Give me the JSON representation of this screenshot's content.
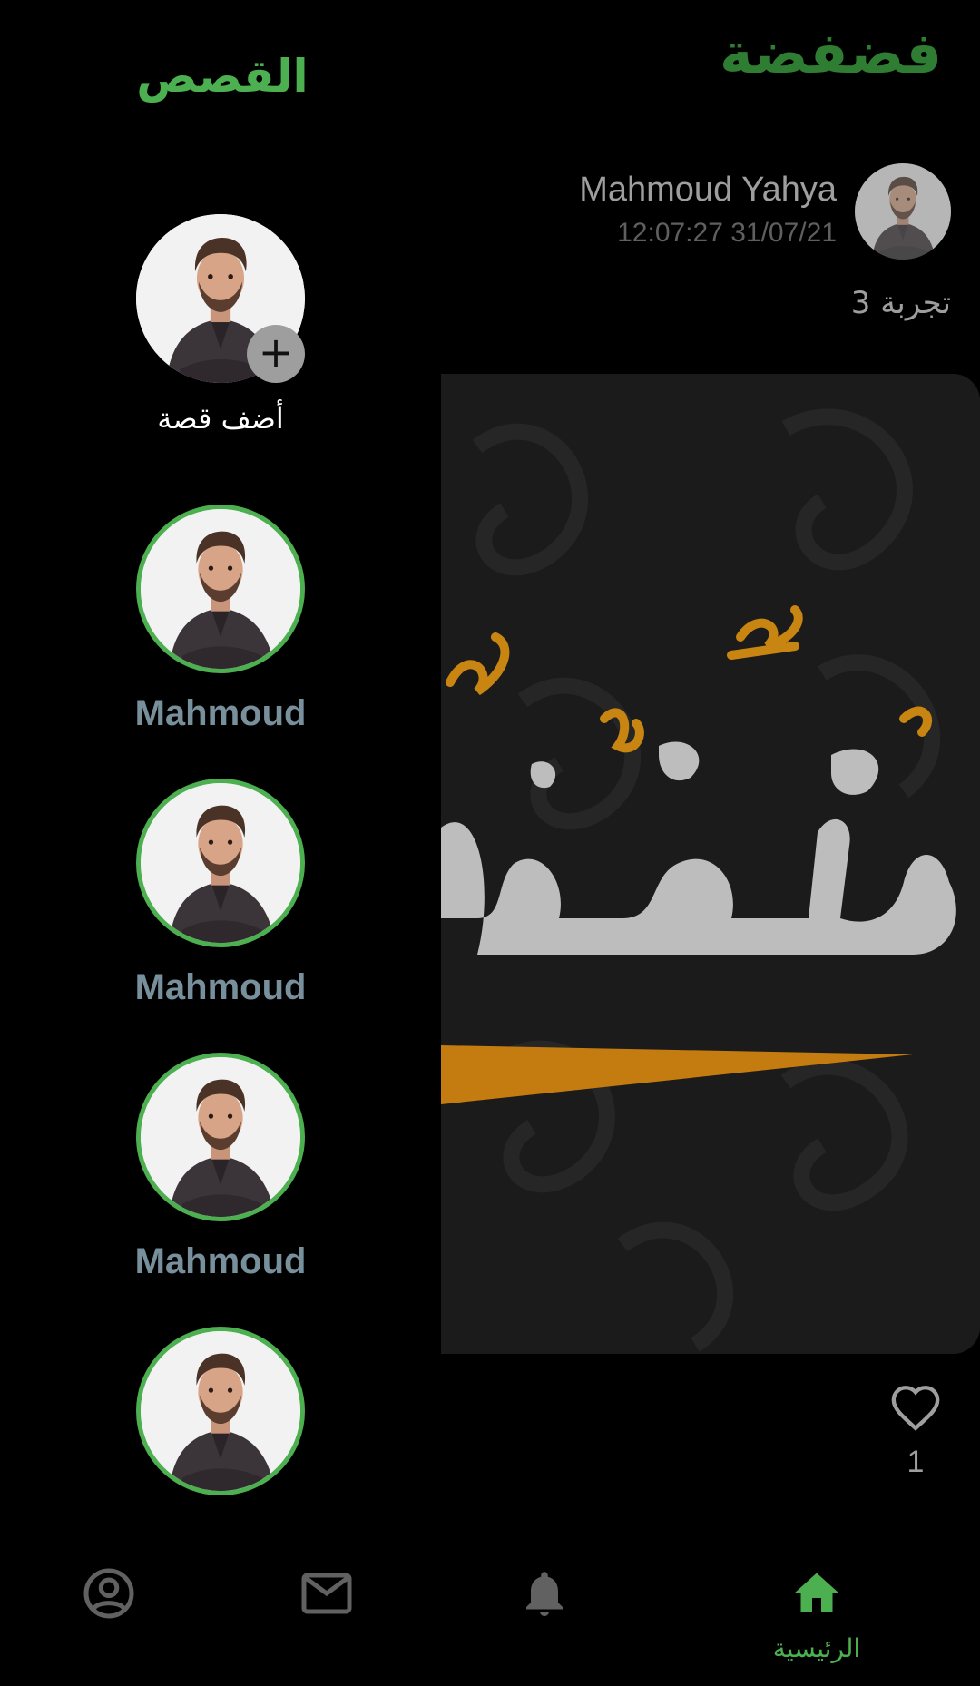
{
  "header": {
    "app_title": "فضفضة",
    "stories_title": "القصص"
  },
  "post": {
    "author": "Mahmoud Yahya",
    "timestamp": "12:07:27 31/07/21",
    "text": "تجربة 3",
    "likes": "1"
  },
  "stories": {
    "add_label": "أضف قصة",
    "items": [
      {
        "name": "Mahmoud"
      },
      {
        "name": "Mahmoud"
      },
      {
        "name": "Mahmoud"
      },
      {
        "name": ""
      }
    ]
  },
  "bottom_nav": {
    "items": [
      {
        "icon": "profile-icon",
        "label": ""
      },
      {
        "icon": "mail-icon",
        "label": ""
      },
      {
        "icon": "bell-icon",
        "label": ""
      },
      {
        "icon": "home-icon",
        "label": "الرئيسية",
        "active": true
      }
    ]
  },
  "colors": {
    "accent": "#4caf50",
    "title_green": "#2e7d32",
    "muted_text": "#9e9e9e",
    "story_name": "#78909c",
    "icon_gray": "#616161",
    "background": "#000000"
  }
}
